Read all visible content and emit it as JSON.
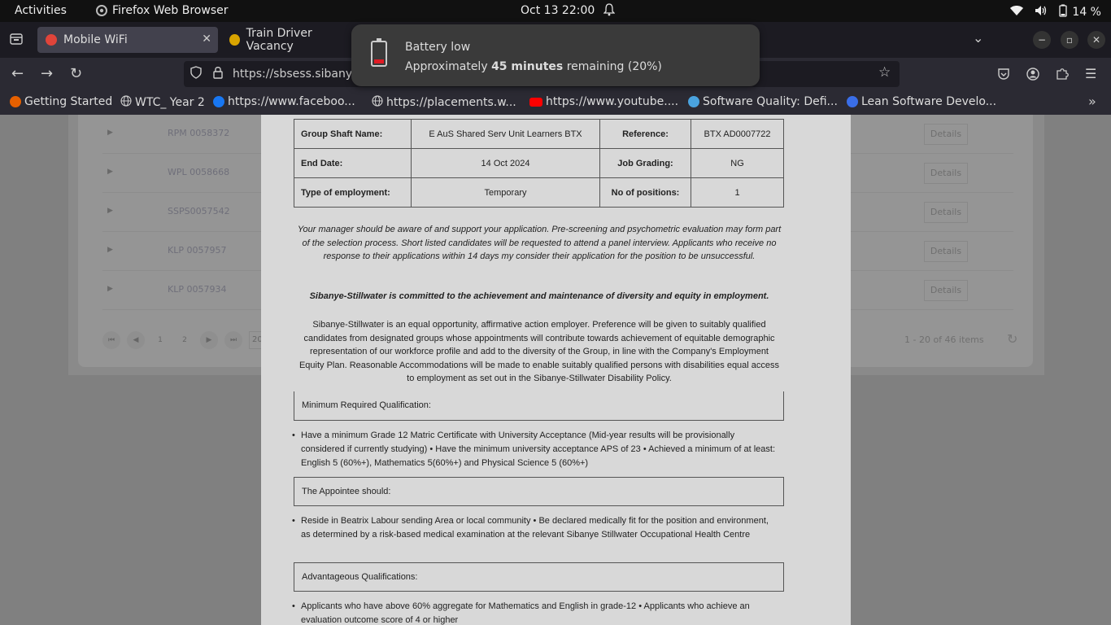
{
  "topbar": {
    "activities": "Activities",
    "app_name": "Firefox Web Browser",
    "clock": "Oct 13  22:00",
    "battery_pct": "14 %"
  },
  "tabs": [
    {
      "label": "Mobile WiFi",
      "favicon_color": "#e0443a"
    },
    {
      "label": "Train Driver Vacancy",
      "favicon_color": "#d9a400"
    }
  ],
  "nav": {
    "url": "https://sbsess.sibany"
  },
  "bookmarks": [
    {
      "label": "Getting Started",
      "icon": "firefox-icon"
    },
    {
      "label": "WTC_ Year 2",
      "icon": "globe-icon"
    },
    {
      "label": "https://www.faceboo...",
      "icon": "facebook-icon"
    },
    {
      "label": "https://placements.w...",
      "icon": "globe-icon"
    },
    {
      "label": "https://www.youtube....",
      "icon": "youtube-icon"
    },
    {
      "label": "Software Quality: Defi...",
      "icon": "software-icon"
    },
    {
      "label": "Lean Software Develo...",
      "icon": "c-icon"
    }
  ],
  "background_list": {
    "rows": [
      {
        "code": "RPM 0058372",
        "detail": "Details"
      },
      {
        "code": "WPL 0058668",
        "detail": "Details"
      },
      {
        "code": "SSPS0057542",
        "detail": "Details"
      },
      {
        "code": "KLP 0057957",
        "detail": "Details"
      },
      {
        "code": "KLP 0057934",
        "detail": "Details"
      }
    ],
    "pager_pages": [
      "1",
      "2"
    ],
    "page_size": "20",
    "items_summary": "1 - 20 of 46 items"
  },
  "job": {
    "group_shaft_label": "Group Shaft Name:",
    "group_shaft_value": "E AuS Shared Serv Unit Learners BTX",
    "reference_label": "Reference:",
    "reference_value": "BTX AD0007722",
    "end_date_label": "End Date:",
    "end_date_value": "14 Oct 2024",
    "job_grading_label": "Job Grading:",
    "job_grading_value": "NG",
    "employment_type_label": "Type of employment:",
    "employment_type_value": "Temporary",
    "positions_label": "No of positions:",
    "positions_value": "1",
    "manager_note": "Your manager should be aware of and support your application. Pre-screening and psychometric evaluation may form part of the selection process. Short listed candidates will be requested to attend a panel interview. Applicants who receive no response to their applications within 14 days my consider their application for the position to be unsuccessful.",
    "diversity_statement": "Sibanye-Stillwater is committed to the achievement and maintenance of diversity and equity in employment.",
    "equal_opportunity": "Sibanye-Stillwater is an equal opportunity, affirmative action employer. Preference will be given to suitably qualified candidates from designated groups whose appointments will contribute towards achievement of equitable demographic representation of our workforce profile and add to the diversity of the Group, in line with the Company's Employment Equity Plan. Reasonable Accommodations will be made to enable suitably qualified persons with disabilities equal access to employment as set out in the Sibanye-Stillwater Disability Policy.",
    "min_qual_heading": "Minimum Required Qualification:",
    "min_qual_text": "Have a minimum Grade 12 Matric Certificate with University Acceptance (Mid-year results will be provisionally considered if currently studying) • Have the minimum university acceptance APS of 23 • Achieved a minimum of at least: English 5 (60%+), Mathematics 5(60%+) and Physical Science 5 (60%+)",
    "appointee_heading": "The Appointee should:",
    "appointee_text": "Reside in Beatrix Labour sending Area or local community • Be declared medically fit for the position and environment, as determined by a risk-based medical examination at the relevant Sibanye Stillwater Occupational Health Centre",
    "adv_qual_heading": "Advantageous Qualifications:",
    "adv_qual_text": "Applicants who have above 60% aggregate for Mathematics and English in grade-12 • Applicants who achieve an evaluation outcome score of 4 or higher"
  },
  "notification": {
    "title": "Battery low",
    "prefix": "Approximately ",
    "bold": "45 minutes",
    "suffix": " remaining (20%)"
  }
}
